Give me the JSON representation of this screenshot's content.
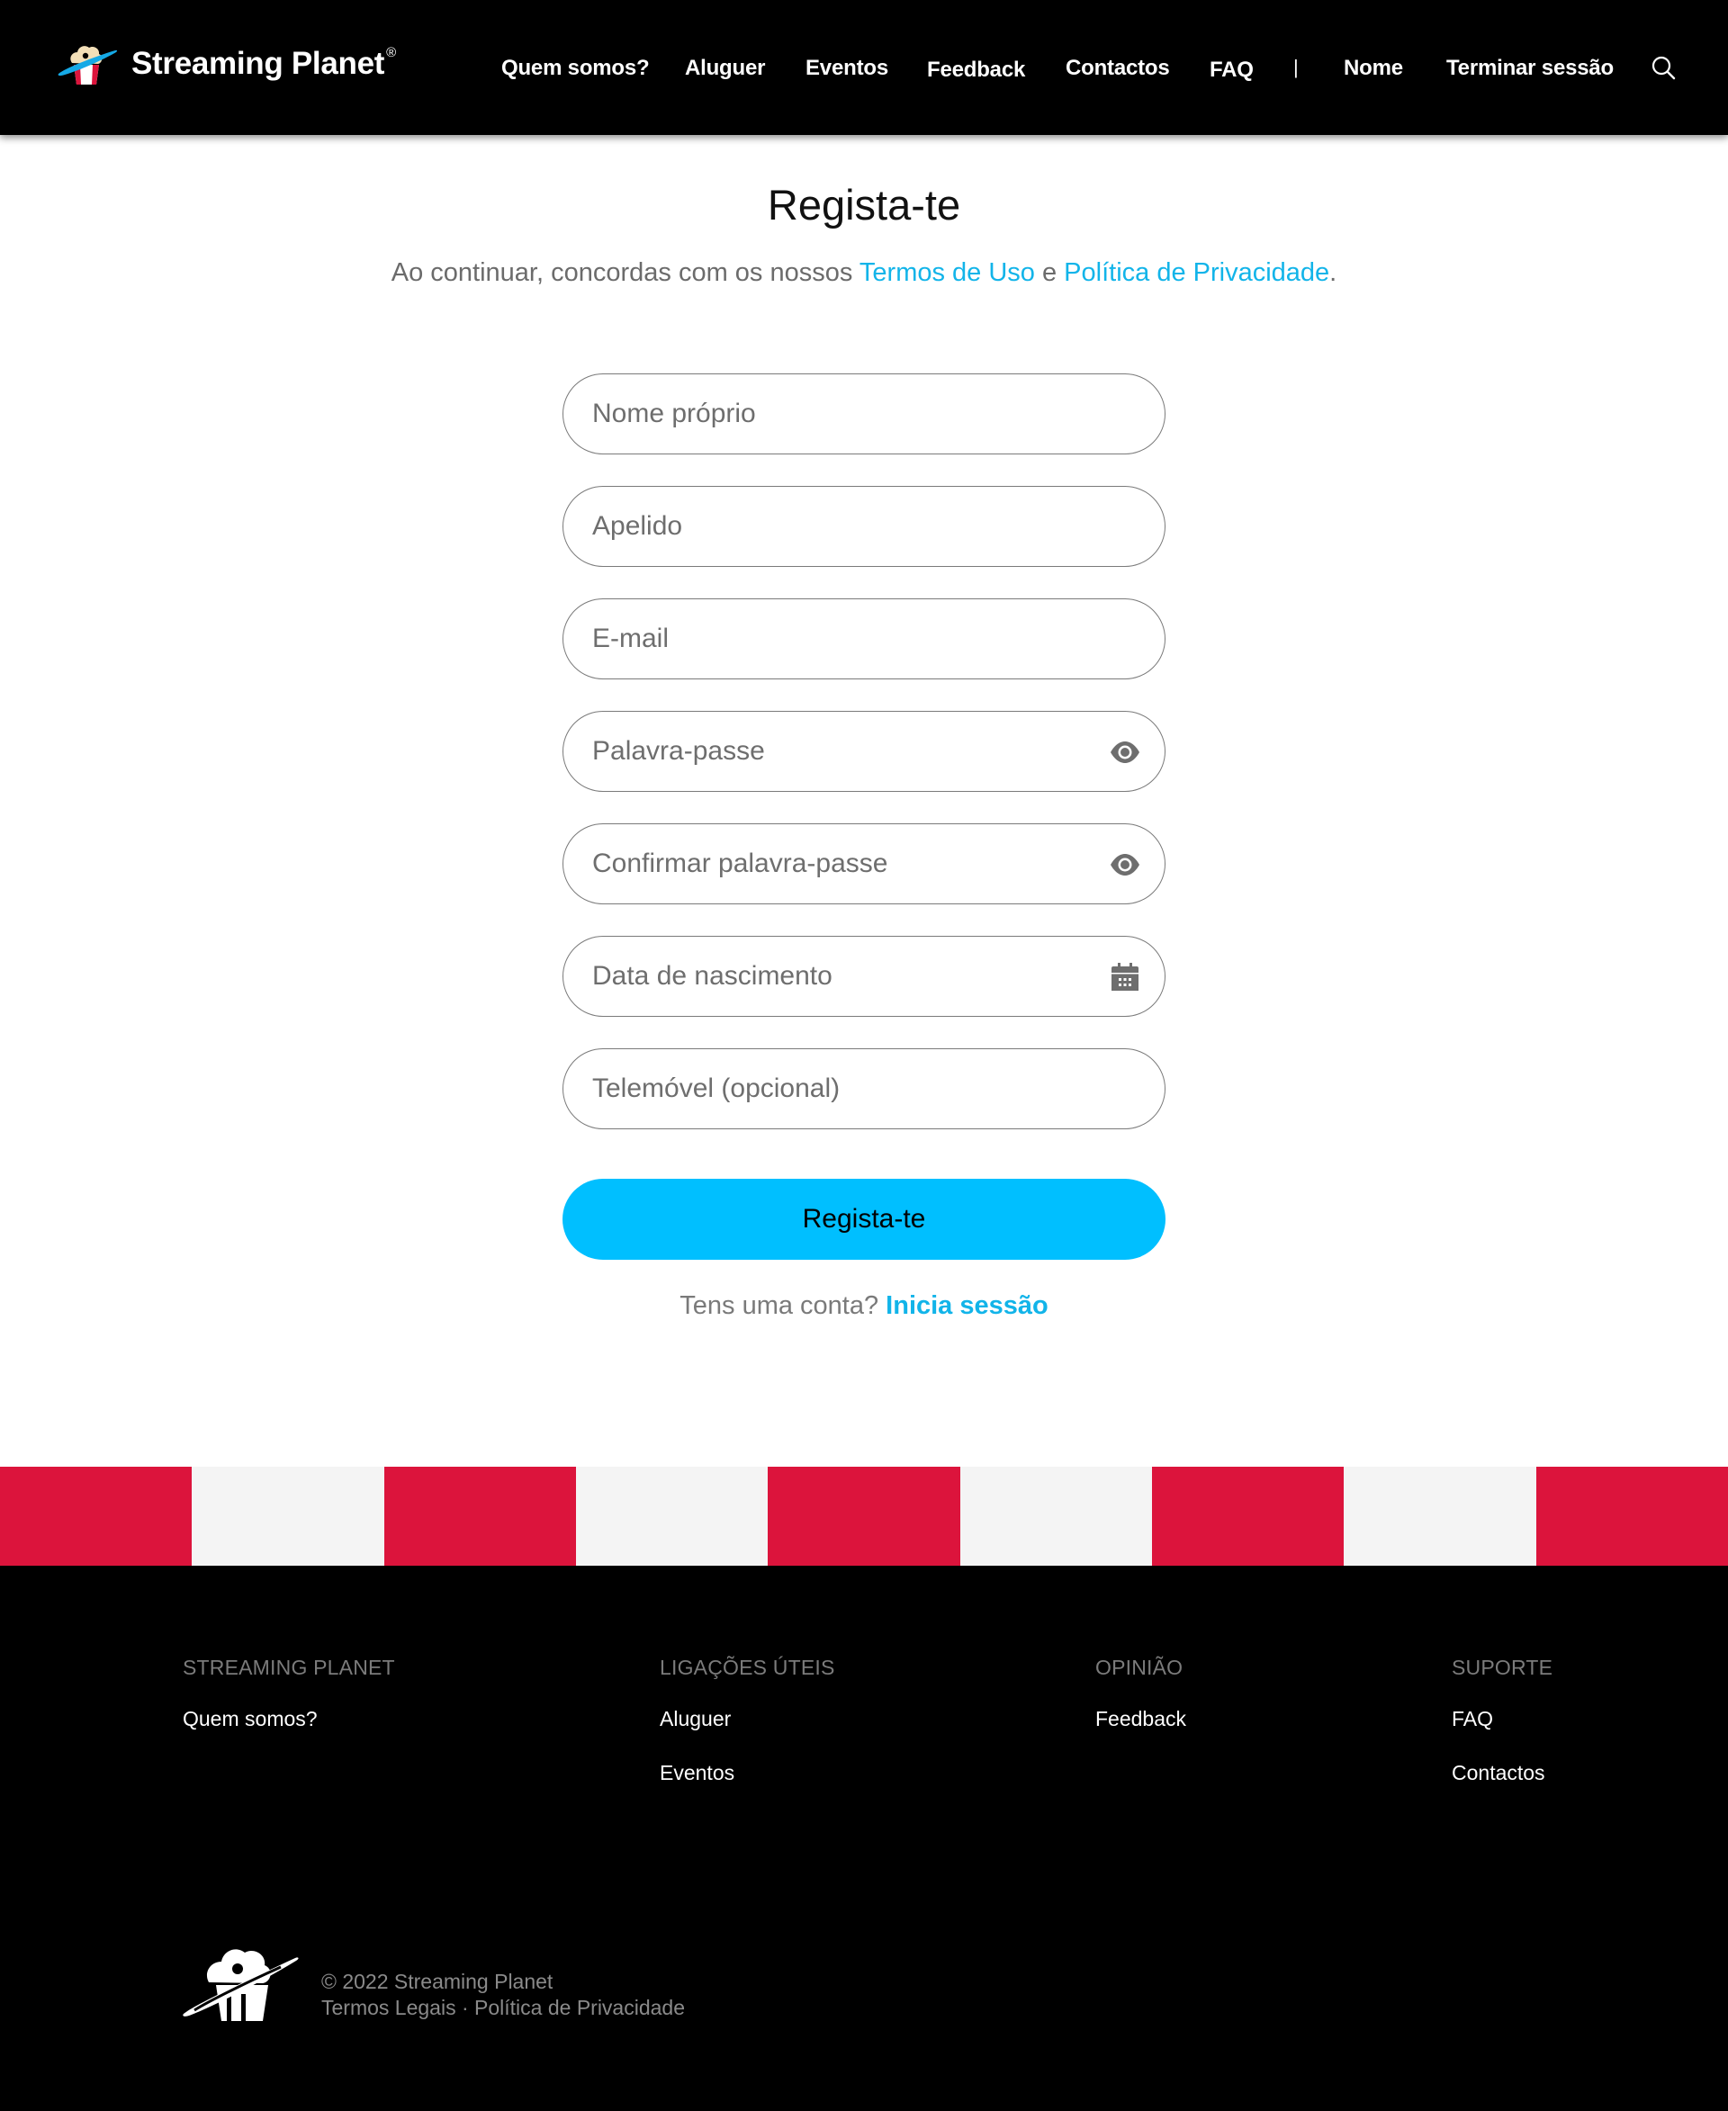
{
  "header": {
    "brand_name": "Streaming Planet",
    "brand_mark": "®",
    "logo_icon": "popcorn-planet-logo",
    "nav": [
      {
        "label": "Quem somos?"
      },
      {
        "label": "Aluguer"
      },
      {
        "label": "Eventos"
      },
      {
        "label": "Feedback"
      },
      {
        "label": "Contactos"
      },
      {
        "label": "FAQ"
      }
    ],
    "separator": "|",
    "user_name": "Nome",
    "logout_label": "Terminar sessão",
    "search_icon": "search-icon"
  },
  "main": {
    "title": "Regista-te",
    "subtitle_prefix": "Ao continuar, concordas com os nossos ",
    "terms_link": "Termos de Uso",
    "subtitle_and": " e ",
    "privacy_link": "Política de Privacidade",
    "subtitle_suffix": ".",
    "fields": [
      {
        "placeholder": "Nome próprio",
        "value": "",
        "icon": null
      },
      {
        "placeholder": "Apelido",
        "value": "",
        "icon": null
      },
      {
        "placeholder": "E-mail",
        "value": "",
        "icon": null
      },
      {
        "placeholder": "Palavra-passe",
        "value": "",
        "icon": "eye-icon"
      },
      {
        "placeholder": "Confirmar palavra-passe",
        "value": "",
        "icon": "eye-icon"
      },
      {
        "placeholder": "Data de nascimento",
        "value": "",
        "icon": "calendar-icon"
      },
      {
        "placeholder": "Telemóvel (opcional)",
        "value": "",
        "icon": null
      }
    ],
    "submit_label": "Regista-te",
    "login_prompt": "Tens uma conta? ",
    "login_link": "Inicia sessão"
  },
  "colors": {
    "accent": "#00bfff",
    "link": "#12b4e9",
    "stripe_red": "#dc143c",
    "stripe_light": "#f4f4f4",
    "header_bg": "#000000",
    "footer_bg": "#000000"
  },
  "footer": {
    "columns": [
      {
        "heading": "STREAMING PLANET",
        "links": [
          "Quem somos?"
        ]
      },
      {
        "heading": "LIGAÇÕES ÚTEIS",
        "links": [
          "Aluguer",
          "Eventos"
        ]
      },
      {
        "heading": "OPINIÃO",
        "links": [
          "Feedback"
        ]
      },
      {
        "heading": "SUPORTE",
        "links": [
          "FAQ",
          "Contactos"
        ]
      }
    ],
    "copyright": "© 2022 Streaming Planet",
    "legal_link": "Termos Legais",
    "legal_sep": " · ",
    "privacy_link": "Política de Privacidade"
  }
}
